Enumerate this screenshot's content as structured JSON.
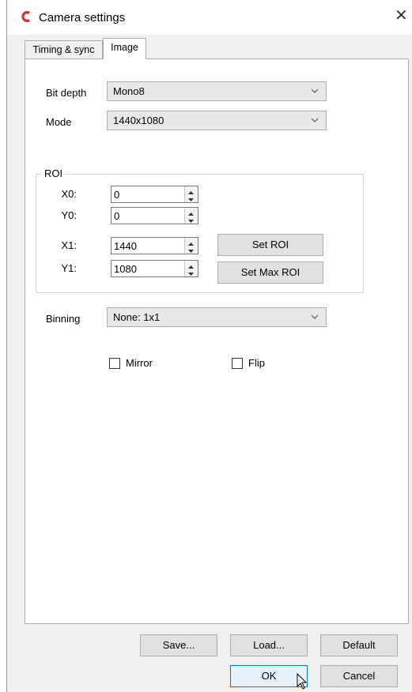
{
  "window": {
    "title": "Camera settings",
    "app_icon": "camera-app-icon",
    "close_glyph": "✕"
  },
  "tabs": [
    {
      "label": "Timing & sync"
    },
    {
      "label": "Image"
    }
  ],
  "image_tab": {
    "bit_depth": {
      "label": "Bit depth",
      "value": "Mono8"
    },
    "mode": {
      "label": "Mode",
      "value": "1440x1080"
    },
    "roi": {
      "title": "ROI",
      "x0": {
        "label": "X0:",
        "value": "0"
      },
      "y0": {
        "label": "Y0:",
        "value": "0"
      },
      "x1": {
        "label": "X1:",
        "value": "1440"
      },
      "y1": {
        "label": "Y1:",
        "value": "1080"
      },
      "set_roi": "Set ROI",
      "set_max_roi": "Set Max ROI"
    },
    "binning": {
      "label": "Binning",
      "value": "None: 1x1"
    },
    "mirror": {
      "label": "Mirror",
      "checked": false
    },
    "flip": {
      "label": "Flip",
      "checked": false
    }
  },
  "footer": {
    "save": "Save...",
    "load": "Load...",
    "default": "Default",
    "ok": "OK",
    "cancel": "Cancel"
  },
  "colors": {
    "app_icon": "#d32f2f",
    "accent": "#0078d7"
  }
}
